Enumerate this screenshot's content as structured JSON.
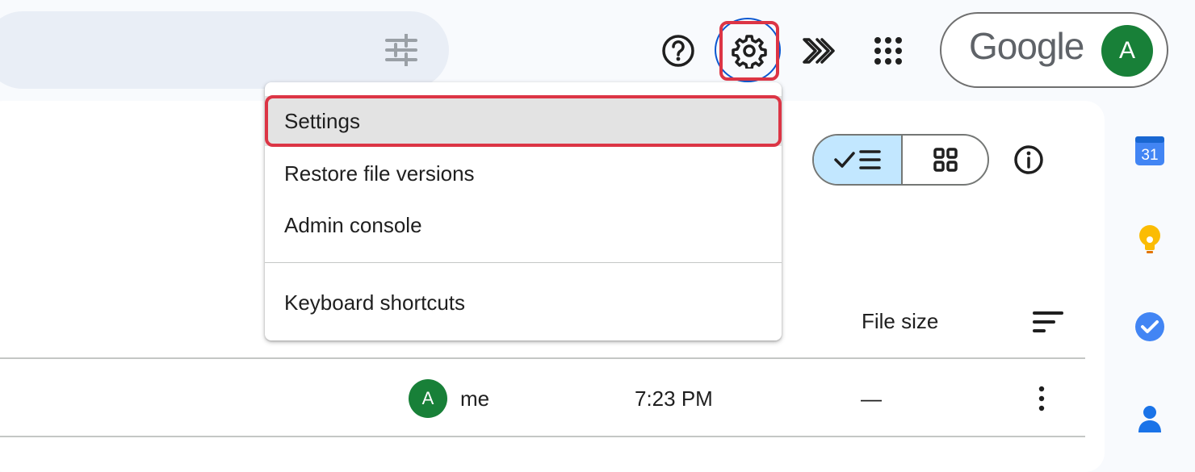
{
  "header": {
    "brand_wordmark": "Google",
    "account_initial": "A",
    "icons": [
      "filter-icon",
      "help-icon",
      "gear-icon",
      "gemini-icon",
      "apps-grid-icon"
    ]
  },
  "settings_menu": {
    "items": [
      {
        "label": "Settings",
        "highlighted": true
      },
      {
        "label": "Restore file versions"
      },
      {
        "label": "Admin console"
      },
      {
        "label": "Keyboard shortcuts"
      }
    ]
  },
  "toolbar": {
    "view_modes": [
      "list",
      "grid"
    ],
    "active_view": "list"
  },
  "file_list": {
    "column_headers": {
      "file_size": "File size"
    },
    "rows": [
      {
        "owner_initial": "A",
        "owner": "me",
        "modified": "7:23 PM",
        "size": "—"
      }
    ]
  },
  "side_panel": {
    "calendar_day": "31",
    "apps": [
      "calendar-icon",
      "keep-icon",
      "tasks-icon",
      "contacts-icon"
    ]
  },
  "colors": {
    "accent_blue": "#0b57d0",
    "highlight_red": "#dc3545",
    "avatar_green": "#188038",
    "toggle_active": "#c2e7ff"
  }
}
